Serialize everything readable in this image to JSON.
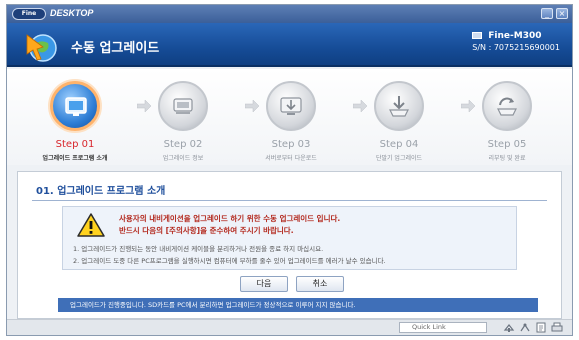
{
  "titlebar": {
    "logo_text": "Fine",
    "brand": "DESKTOP",
    "minimize": "_",
    "close": "×"
  },
  "header": {
    "title": "수동 업그레이드",
    "device_name": "Fine-M300",
    "serial": "S/N : 7075215690001"
  },
  "steps": [
    {
      "title": "Step 01",
      "subtitle": "업그레이드 프로그램 소개",
      "active": true,
      "icon": "monitor-icon"
    },
    {
      "title": "Step 02",
      "subtitle": "업그레이드 정보",
      "active": false,
      "icon": "device-icon"
    },
    {
      "title": "Step 03",
      "subtitle": "서버로부터 다운로드",
      "active": false,
      "icon": "download-icon"
    },
    {
      "title": "Step 04",
      "subtitle": "단말기 업그레이드",
      "active": false,
      "icon": "upgrade-icon"
    },
    {
      "title": "Step 05",
      "subtitle": "리부팅 및 완료",
      "active": false,
      "icon": "reboot-icon"
    }
  ],
  "content": {
    "section_title": "01. 업그레이드 프로그램 소개",
    "warning_line1": "사용자의 내비게이션을 업그레이드 하기 위한 수동 업그레이드 입니다.",
    "warning_line2": "반드시 다음의 [주의사항]을 준수하여 주시기 바랍니다.",
    "notes": [
      "1. 업그레이드가 진행되는 동안 내비게이션 케이블을 분리하거나 전원을 종료 하지 마십시요.",
      "2. 업그레이드 도중 다른 PC프로그램을 실행하시면 컴퓨터에 부하를 줄수 있어 업그레이드를 에러가 날수 있습니다."
    ],
    "next_button": "다음",
    "cancel_button": "취소",
    "status": "업그레이드가 진행중입니다. SD카드를 PC에서 분리하면 업그레이드가 정상적으로 이루어 지지 않습니다."
  },
  "bottom": {
    "quick_link": "Quick Link"
  },
  "colors": {
    "header_blue": "#164c97",
    "active_step_red": "#d8262c",
    "status_blue": "#3f6fb8"
  }
}
